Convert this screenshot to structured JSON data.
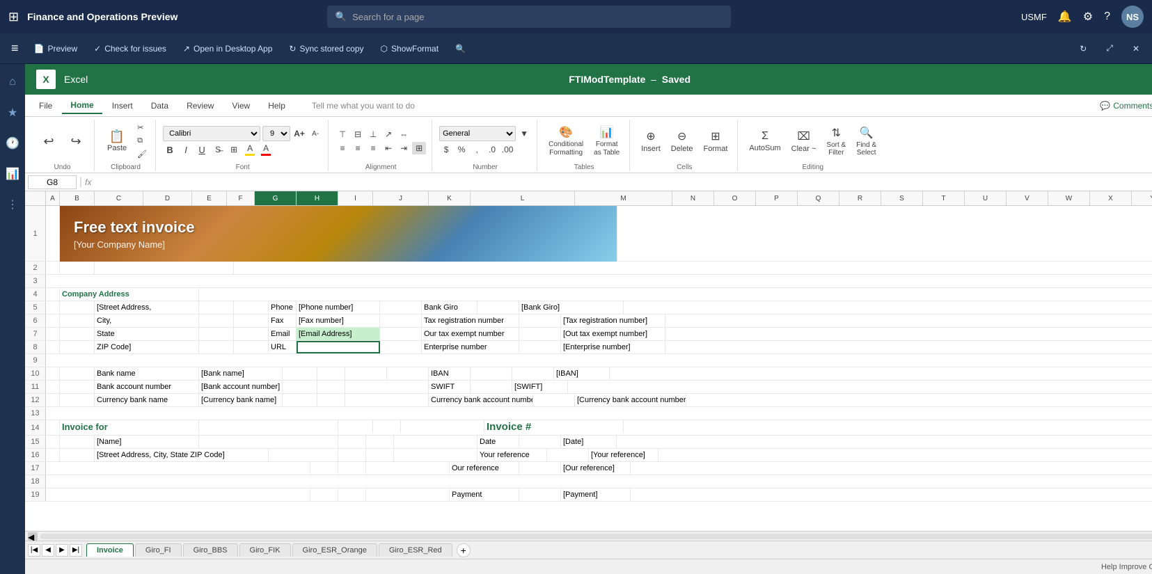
{
  "topNav": {
    "appGrid": "⊞",
    "appTitle": "Finance and Operations Preview",
    "searchPlaceholder": "Search for a page",
    "rightItems": [
      "USMF",
      "🔔",
      "⚙",
      "?"
    ],
    "avatar": "NS"
  },
  "foToolbar": {
    "sidebarToggle": "≡",
    "buttons": [
      {
        "label": "Preview",
        "icon": "📄"
      },
      {
        "label": "Check for issues",
        "icon": "✓"
      },
      {
        "label": "Open in Desktop App",
        "icon": "↗"
      },
      {
        "label": "Sync stored copy",
        "icon": "↻"
      },
      {
        "label": "ShowFormat",
        "icon": "🔧"
      }
    ],
    "searchIcon": "🔍"
  },
  "sidebar": {
    "icons": [
      "⌂",
      "★",
      "🕐",
      "📊",
      "≡"
    ]
  },
  "excelTitleBar": {
    "logo": "X",
    "appLabel": "Excel",
    "fileName": "FTIModTemplate",
    "separator": "–",
    "savedLabel": "Saved"
  },
  "ribbonTabs": [
    {
      "label": "File",
      "active": false
    },
    {
      "label": "Home",
      "active": true
    },
    {
      "label": "Insert",
      "active": false
    },
    {
      "label": "Data",
      "active": false
    },
    {
      "label": "Review",
      "active": false
    },
    {
      "label": "View",
      "active": false
    },
    {
      "label": "Help",
      "active": false
    }
  ],
  "tellMe": "Tell me what you want to do",
  "comments": "Comments",
  "ribbon": {
    "undoIcon": "↩",
    "redoIcon": "↪",
    "pasteLabel": "Paste",
    "cutIcon": "✂",
    "copyIcon": "⧉",
    "formatPainterIcon": "🖌",
    "fontName": "Calibri",
    "fontSize": "9",
    "fontGrowIcon": "A+",
    "fontShrinkIcon": "A-",
    "boldLabel": "B",
    "italicLabel": "I",
    "underlineLabel": "U",
    "strikeLabel": "S",
    "alignLeftIcon": "≡",
    "alignCenterIcon": "≡",
    "alignRightIcon": "≡",
    "wrapTextIcon": "⇔",
    "mergeIcon": "⊞",
    "numberFormat": "General",
    "currencyIcon": "$",
    "percentIcon": "%",
    "commaIcon": ",",
    "decIncIcon": ".0",
    "decDecIcon": ".00",
    "conditionalFormattingLabel": "Conditional\nFormatting",
    "formatAsTableLabel": "Format\nas Table",
    "insertLabel": "Insert",
    "deleteLabel": "Delete",
    "formatLabel": "Format",
    "autoSumLabel": "AutoSum",
    "sortFilterLabel": "Sort &\nFilter",
    "findSelectLabel": "Find &\nSelect",
    "clearLabel": "Clear ~",
    "undoGroupLabel": "Undo",
    "clipboardGroupLabel": "Clipboard",
    "fontGroupLabel": "Font",
    "alignGroupLabel": "Alignment",
    "numberGroupLabel": "Number",
    "tablesGroupLabel": "Tables",
    "cellsGroupLabel": "Cells",
    "editingGroupLabel": "Editing"
  },
  "formulaBar": {
    "nameBox": "G8",
    "fxLabel": "fx",
    "formula": ""
  },
  "columns": [
    "A",
    "B",
    "C",
    "D",
    "E",
    "F",
    "G",
    "H",
    "I",
    "J",
    "K",
    "L",
    "M",
    "N",
    "O",
    "P",
    "Q",
    "R",
    "S",
    "T",
    "U",
    "V",
    "W",
    "X",
    "Y"
  ],
  "selectedColumns": [
    "G",
    "H"
  ],
  "invoiceHeader": {
    "title": "Free text invoice",
    "companyName": "[Your Company Name]"
  },
  "rows": [
    {
      "num": 1,
      "isHeader": true
    },
    {
      "num": 2,
      "companyName": "[Your Company Name]"
    },
    {
      "num": 3
    },
    {
      "num": 4,
      "label": "Company Address"
    },
    {
      "num": 5,
      "street": "[Street Address,",
      "phoneLabel": "Phone",
      "phoneVal": "[Phone number]",
      "bankGiroLabel": "Bank Giro",
      "bankGiroVal": "[Bank Giro]"
    },
    {
      "num": 6,
      "city": "City,",
      "faxLabel": "Fax",
      "faxVal": "[Fax number]",
      "taxLabel": "Tax registration number",
      "taxVal": "[Tax registration number]"
    },
    {
      "num": 7,
      "state": "State",
      "emailLabel": "Email",
      "emailVal": "[Email Address]",
      "taxExemptLabel": "Our tax exempt number",
      "taxExemptVal": "[Out tax exempt number]"
    },
    {
      "num": 8,
      "zip": "ZIP Code]",
      "urlLabel": "URL",
      "urlVal": "",
      "enterpriseLabel": "Enterprise number",
      "enterpriseVal": "[Enterprise number]"
    },
    {
      "num": 9
    },
    {
      "num": 10,
      "bankNameLabel": "Bank name",
      "bankNameVal": "[Bank name]",
      "ibanLabel": "IBAN",
      "ibanVal": "[IBAN]"
    },
    {
      "num": 11,
      "bankAccLabel": "Bank account number",
      "bankAccVal": "[Bank account number]",
      "swiftLabel": "SWIFT",
      "swiftVal": "[SWIFT]"
    },
    {
      "num": 12,
      "currencyLabel": "Currency bank name",
      "currencyVal": "[Currency bank name]",
      "currencyAccLabel": "Currency bank account number",
      "currencyAccVal": "[Currency bank account number]"
    },
    {
      "num": 13
    },
    {
      "num": 14,
      "invoiceForLabel": "Invoice for",
      "invoiceHashLabel": "Invoice #"
    },
    {
      "num": 15,
      "nameVal": "[Name]",
      "dateLabel": "Date",
      "dateVal": "[Date]"
    },
    {
      "num": 16,
      "addressVal": "[Street Address, City, State ZIP Code]",
      "yourRefLabel": "Your reference",
      "yourRefVal": "[Your reference]"
    },
    {
      "num": 17,
      "ourRefLabel": "Our reference",
      "ourRefVal": "[Our reference]"
    },
    {
      "num": 18
    },
    {
      "num": 19,
      "paymentLabel": "Payment",
      "paymentVal": "[Payment]"
    }
  ],
  "sheetTabs": [
    {
      "label": "Invoice",
      "active": true
    },
    {
      "label": "Giro_FI",
      "active": false
    },
    {
      "label": "Giro_BBS",
      "active": false
    },
    {
      "label": "Giro_FIK",
      "active": false
    },
    {
      "label": "Giro_ESR_Orange",
      "active": false
    },
    {
      "label": "Giro_ESR_Red",
      "active": false
    }
  ],
  "statusBar": {
    "helpText": "Help Improve Office"
  }
}
